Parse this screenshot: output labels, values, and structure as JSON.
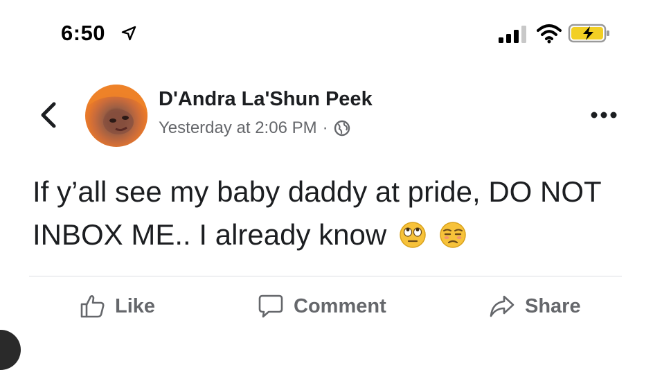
{
  "status_bar": {
    "time": "6:50",
    "icons": [
      "location-arrow-icon",
      "cellular-signal-icon",
      "wifi-icon",
      "battery-charging-icon"
    ]
  },
  "nav": {
    "back_icon": "chevron-left-icon",
    "more_icon": "more-horizontal-icon"
  },
  "post": {
    "author_name": "D'Andra La'Shun Peek",
    "timestamp": "Yesterday at 2:06 PM",
    "separator": "·",
    "privacy_icon": "globe-icon",
    "text": "If y’all see my baby daddy at pride, DO NOT INBOX ME.. I already know",
    "emojis": [
      "face-with-rolling-eyes-icon",
      "unamused-face-icon"
    ]
  },
  "actions": {
    "like_label": "Like",
    "comment_label": "Comment",
    "share_label": "Share"
  },
  "colors": {
    "text_primary": "#1c1e21",
    "text_secondary": "#65676b",
    "divider": "#dcdde1",
    "emoji_yellow": "#f7c23a"
  }
}
